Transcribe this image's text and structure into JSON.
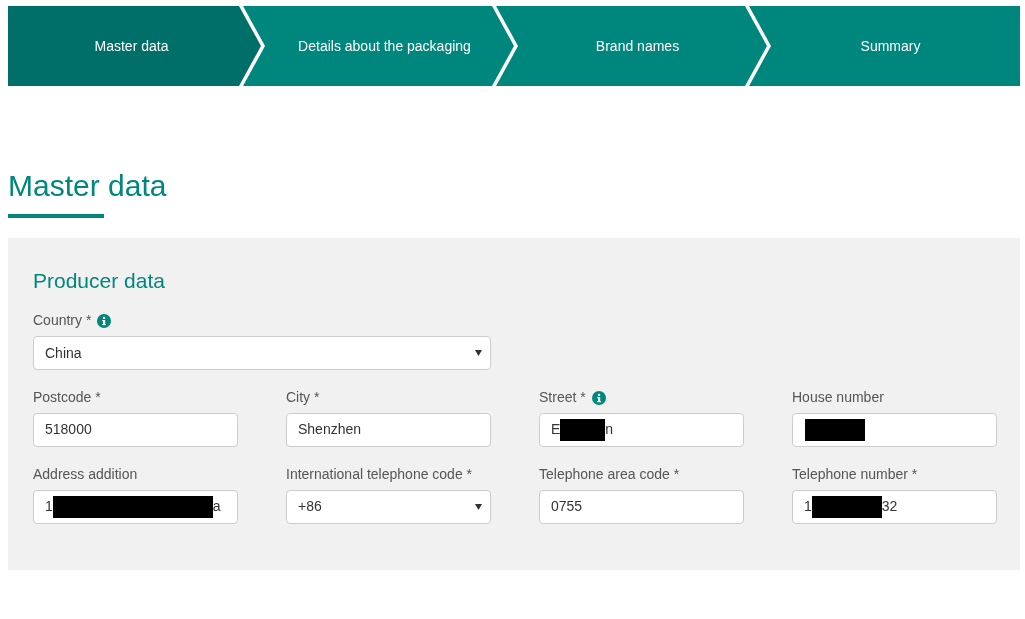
{
  "steps": [
    {
      "label": "Master data",
      "selected": true
    },
    {
      "label": "Details about the packaging",
      "selected": false
    },
    {
      "label": "Brand names",
      "selected": false
    },
    {
      "label": "Summary",
      "selected": false
    }
  ],
  "heading": "Master data",
  "section": {
    "title": "Producer data",
    "rows": [
      [
        {
          "kind": "select",
          "label": "Country *",
          "info": true,
          "value": "China",
          "wide": true
        }
      ],
      [
        {
          "kind": "input",
          "label": "Postcode *",
          "info": false,
          "value": "518000"
        },
        {
          "kind": "input",
          "label": "City *",
          "info": false,
          "value": "Shenzhen"
        },
        {
          "kind": "input",
          "label": "Street *",
          "info": true,
          "value": "E",
          "value_end": "n",
          "redacted": true
        },
        {
          "kind": "input",
          "label": "House number",
          "info": false,
          "redacted": true
        }
      ],
      [
        {
          "kind": "input",
          "label": "Address addition",
          "info": false,
          "value": "1",
          "value_end": "a",
          "redacted": true
        },
        {
          "kind": "select",
          "label": "International telephone code *",
          "info": false,
          "value": "+86"
        },
        {
          "kind": "input",
          "label": "Telephone area code *",
          "info": false,
          "value": "0755"
        },
        {
          "kind": "input",
          "label": "Telephone number *",
          "info": false,
          "value": "1",
          "value_end": "32",
          "redacted": true
        }
      ]
    ]
  }
}
